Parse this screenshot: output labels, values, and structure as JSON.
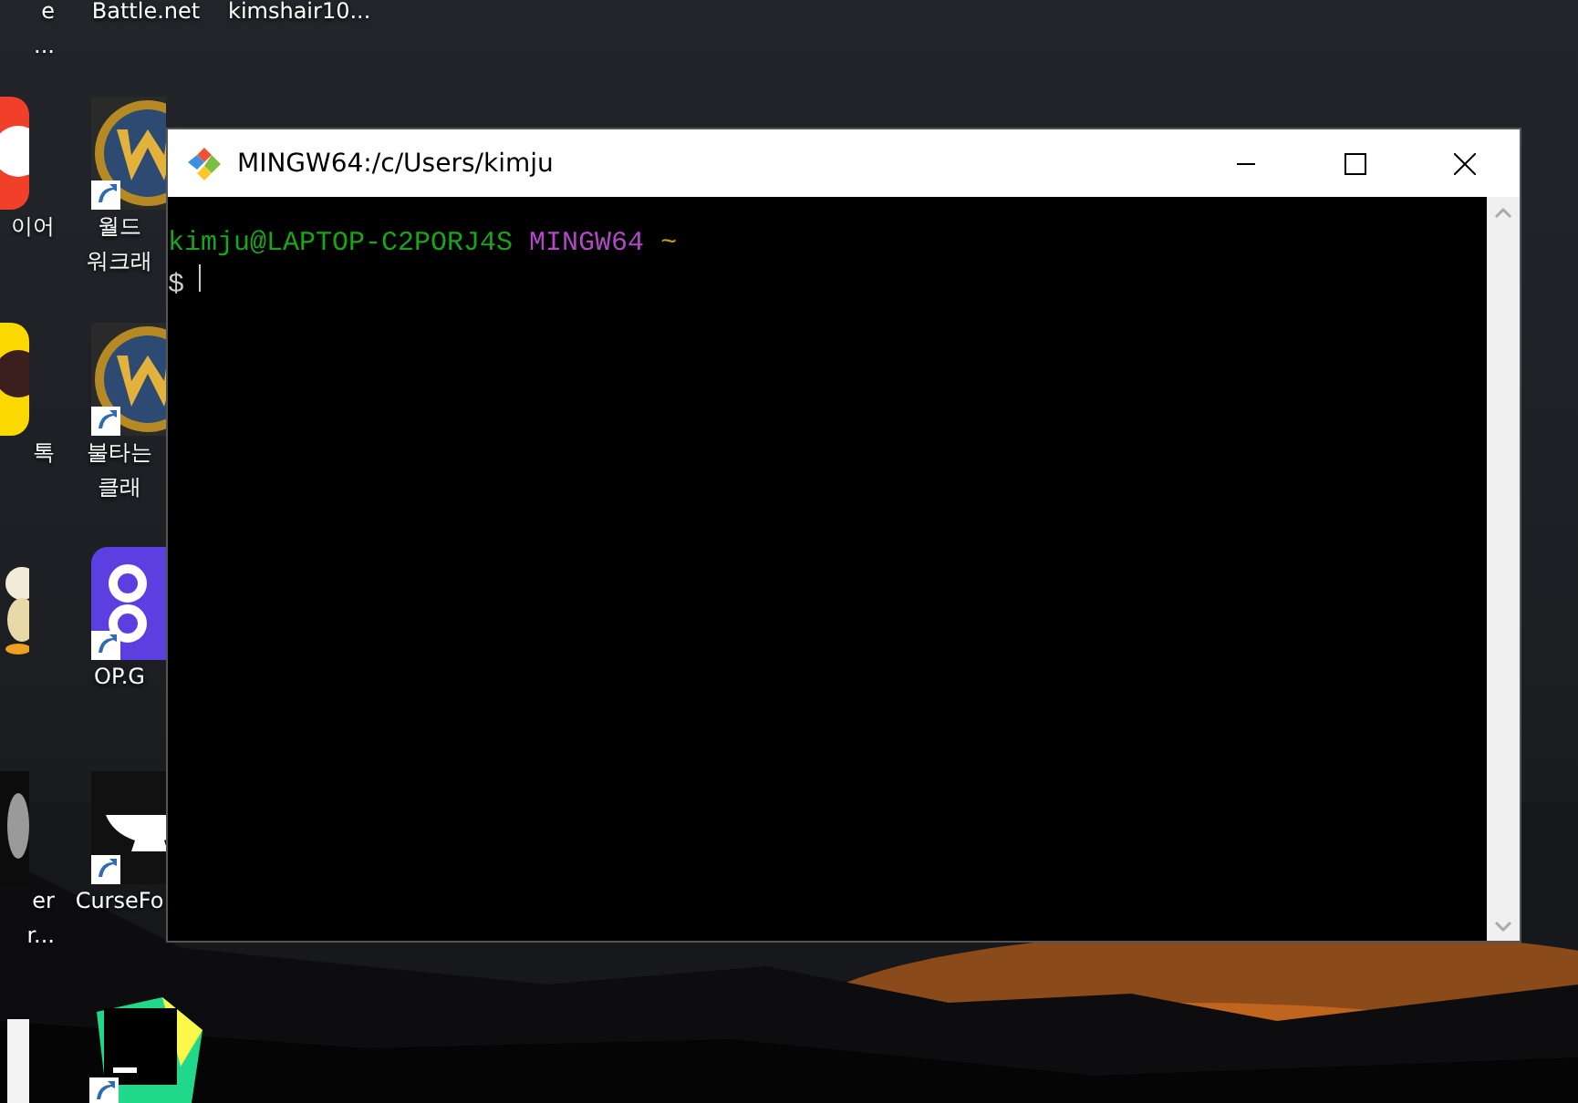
{
  "desktop_icons": [
    {
      "kind": "partial",
      "label": [
        "e",
        "..."
      ]
    },
    {
      "kind": "battle",
      "label": [
        "Battle.net"
      ]
    },
    {
      "kind": "partial",
      "label": [
        "kimshair10..."
      ]
    },
    {
      "kind": "red-app",
      "label": [
        "이어"
      ]
    },
    {
      "kind": "wow",
      "label": [
        "월드",
        "워크래"
      ]
    },
    {
      "kind": "yellow-app",
      "label": [
        "톡"
      ]
    },
    {
      "kind": "wow",
      "label": [
        "불타는",
        "클래"
      ]
    },
    {
      "kind": "figure"
    },
    {
      "kind": "opgg",
      "label": [
        "OP.G"
      ]
    },
    {
      "kind": "dark-app",
      "label": [
        "er",
        "r..."
      ]
    },
    {
      "kind": "anvil",
      "label": [
        "CurseFo"
      ]
    },
    {
      "kind": "white-app"
    },
    {
      "kind": "pycharm"
    }
  ],
  "window": {
    "title": "MINGW64:/c/Users/kimju",
    "prompt": {
      "user": "kimju@LAPTOP-C2PORJ4S",
      "system": "MINGW64",
      "path": "~",
      "symbol": "$"
    }
  }
}
